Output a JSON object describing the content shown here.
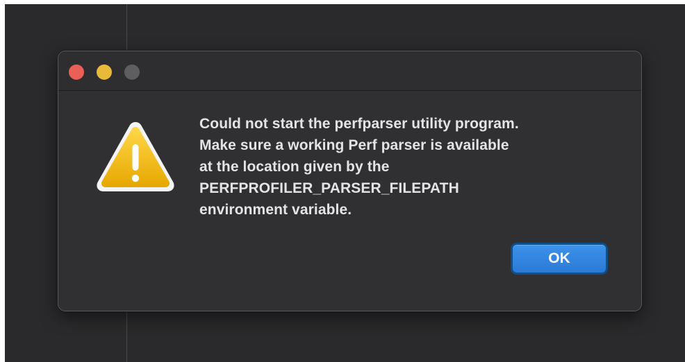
{
  "dialog": {
    "message_lines": [
      "Could not start the perfparser utility program.",
      "Make sure a working Perf parser is available",
      "at the location given by the",
      "PERFPROFILER_PARSER_FILEPATH",
      "environment variable."
    ],
    "ok_label": "OK",
    "icon": "warning-icon"
  },
  "window_controls": [
    "close",
    "minimize",
    "zoom"
  ],
  "colors": {
    "background": "#2a2a2c",
    "dialog": "#303032",
    "accent": "#2f82e0",
    "warning": "#f0b800",
    "close": "#ec5f57",
    "minimize": "#e9b93a",
    "zoom_disabled": "#5e5e61"
  }
}
